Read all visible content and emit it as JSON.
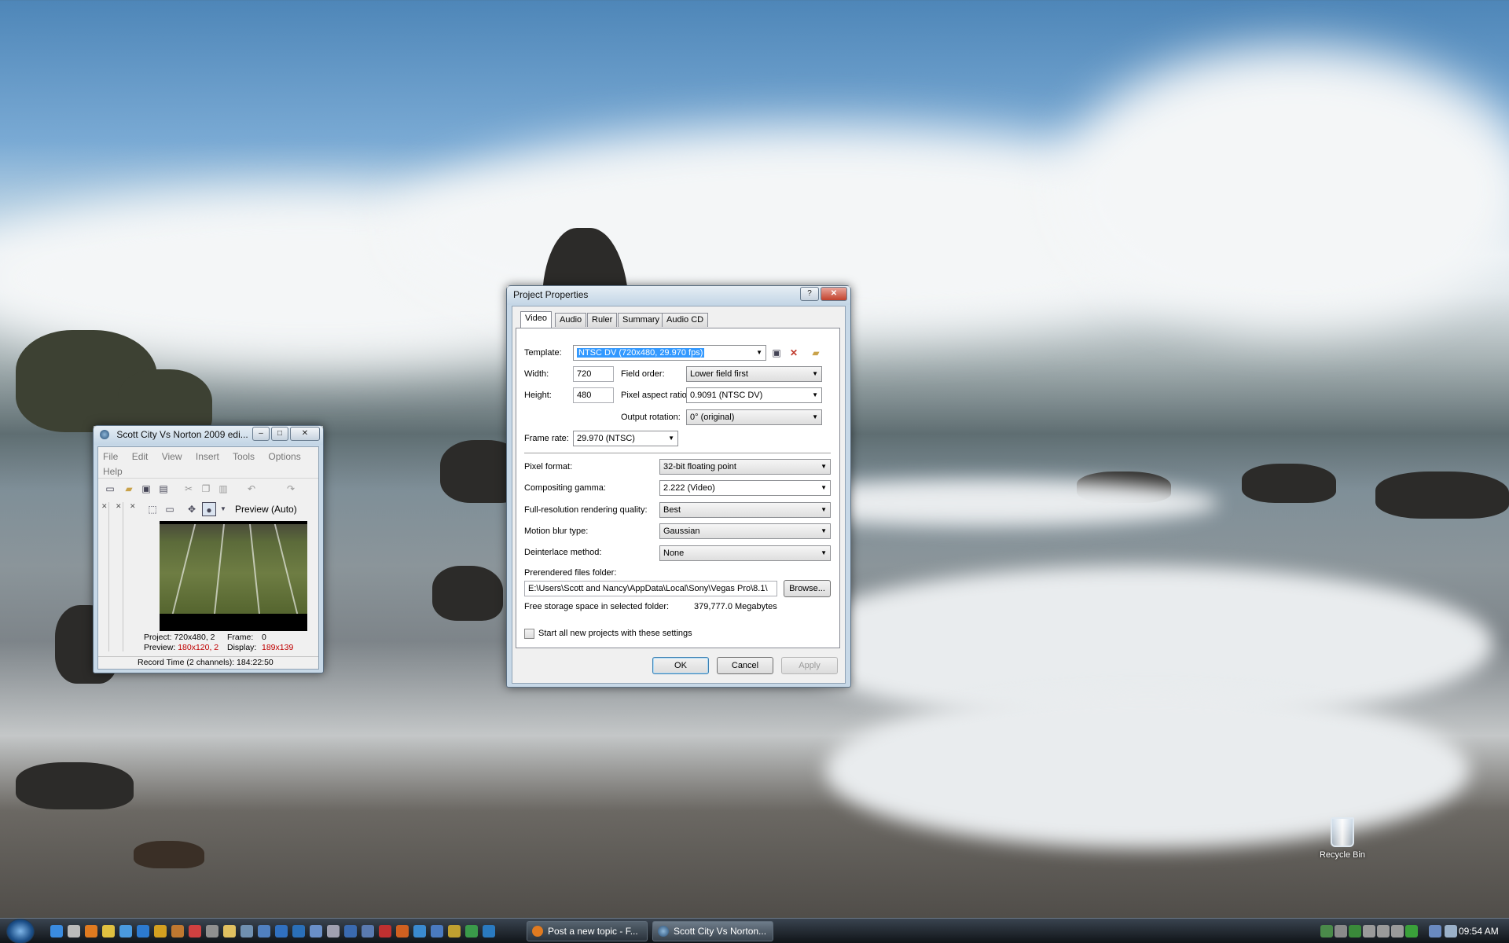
{
  "dialog": {
    "title": "Project Properties",
    "tabs": [
      "Video",
      "Audio",
      "Ruler",
      "Summary",
      "Audio CD"
    ],
    "template_label": "Template:",
    "template_value": "NTSC DV (720x480, 29.970 fps)",
    "width_label": "Width:",
    "width_value": "720",
    "height_label": "Height:",
    "height_value": "480",
    "field_order_label": "Field order:",
    "field_order_value": "Lower field first",
    "pixel_aspect_label": "Pixel aspect ratio:",
    "pixel_aspect_value": "0.9091 (NTSC DV)",
    "output_rotation_label": "Output rotation:",
    "output_rotation_value": "0° (original)",
    "frame_rate_label": "Frame rate:",
    "frame_rate_value": "29.970 (NTSC)",
    "pixel_format_label": "Pixel format:",
    "pixel_format_value": "32-bit floating point",
    "gamma_label": "Compositing gamma:",
    "gamma_value": "2.222 (Video)",
    "quality_label": "Full-resolution rendering quality:",
    "quality_value": "Best",
    "blur_label": "Motion blur type:",
    "blur_value": "Gaussian",
    "deinterlace_label": "Deinterlace method:",
    "deinterlace_value": "None",
    "folder_label": "Prerendered files folder:",
    "folder_value": "E:\\Users\\Scott and Nancy\\AppData\\Local\\Sony\\Vegas Pro\\8.1\\",
    "browse_label": "Browse...",
    "free_space_label": "Free storage space in selected folder:",
    "free_space_value": "379,777.0 Megabytes",
    "start_all_label": "Start all new projects with these settings",
    "ok": "OK",
    "cancel": "Cancel",
    "apply": "Apply",
    "help_glyph": "?",
    "close_glyph": "✕"
  },
  "vegas": {
    "title": "Scott City Vs Norton 2009 edi...",
    "menu": [
      "File",
      "Edit",
      "View",
      "Insert",
      "Tools",
      "Options",
      "Help"
    ],
    "preview_label": "Preview (Auto)",
    "project_label": "Project:",
    "project_value": "720x480, 2",
    "preview_res_label": "Preview:",
    "preview_res_value": "180x120, 2",
    "frame_label": "Frame:",
    "frame_value": "0",
    "display_label": "Display:",
    "display_value": "189x139",
    "record_time": "Record Time (2 channels): 184:22:50"
  },
  "desktop": {
    "recycle_bin": "Recycle Bin"
  },
  "taskbar": {
    "tasks": [
      "Post a new topic - F...",
      "Scott City Vs Norton..."
    ],
    "clock": "09:54 AM"
  },
  "colors": {
    "selection": "#3399ff",
    "ok_border": "#3c7fb1",
    "red_value": "#c00000"
  }
}
